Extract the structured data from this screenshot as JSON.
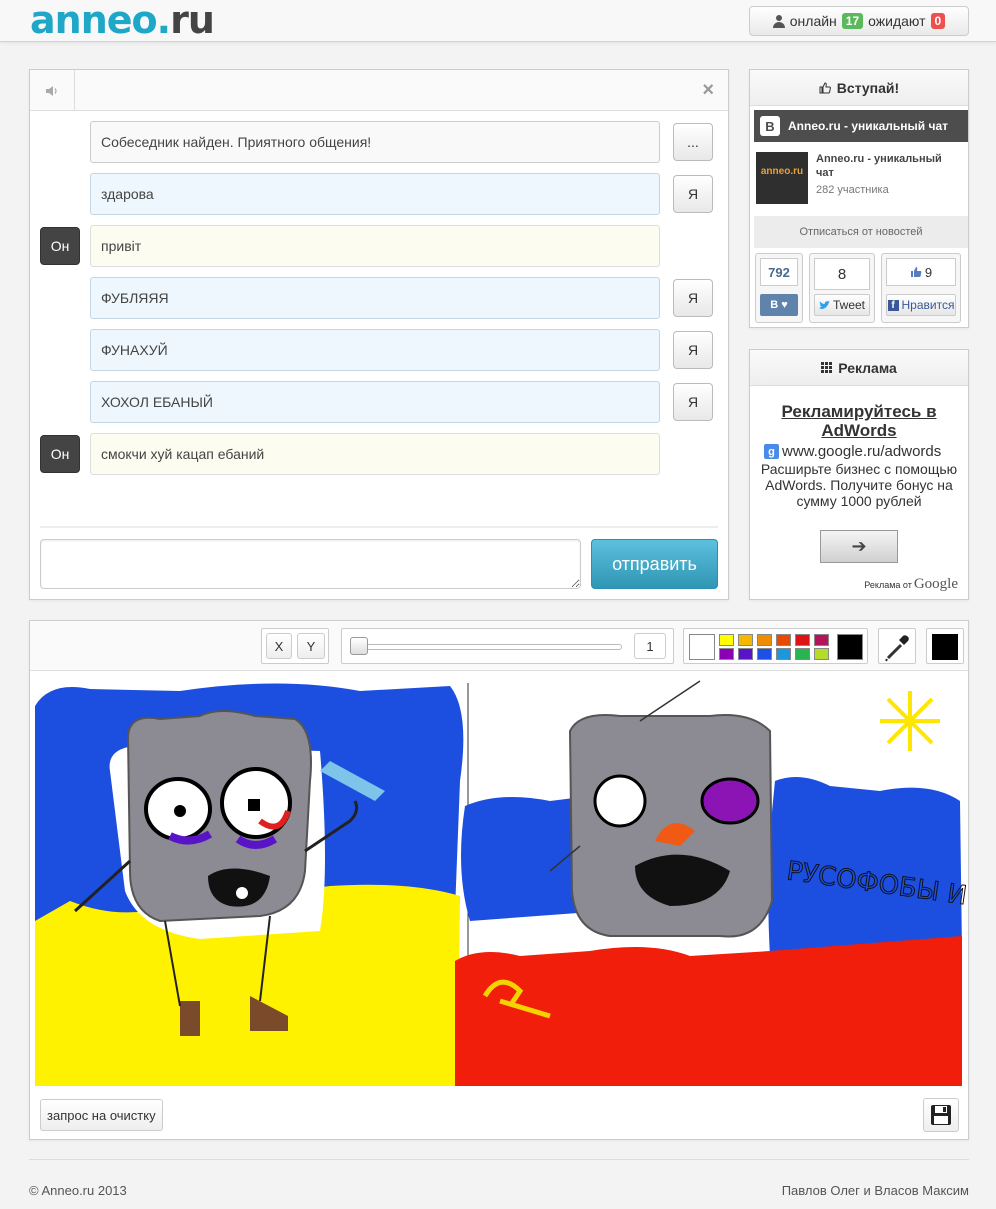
{
  "header": {
    "logo": {
      "main": "anneo",
      "dot": ".",
      "tld": "ru"
    },
    "status": {
      "online_label": "онлайн",
      "online_count": "17",
      "waiting_label": "ожидают",
      "waiting_count": "0"
    }
  },
  "chat": {
    "messages": [
      {
        "text": "Собеседник найден. Приятного общения!",
        "kind": "system",
        "side_label": "..."
      },
      {
        "text": "здарова",
        "kind": "me",
        "side_label": "Я"
      },
      {
        "text": "привіт",
        "kind": "him",
        "side_label": "Он"
      },
      {
        "text": "ФУБЛЯЯЯ",
        "kind": "me",
        "side_label": "Я"
      },
      {
        "text": "ФУНАХУЙ",
        "kind": "me",
        "side_label": "Я"
      },
      {
        "text": "ХОХОЛ ЕБАНЫЙ",
        "kind": "me",
        "side_label": "Я"
      },
      {
        "text": "смокчи хуй кацап ебаний",
        "kind": "him",
        "side_label": "Он"
      }
    ],
    "input_value": "",
    "send_label": "отправить"
  },
  "vk": {
    "title": "Вступай!",
    "group_header": "Anneo.ru - уникальный чат",
    "avatar_text": "anneo.ru",
    "group_name": "Anneo.ru - уникальный чат",
    "members": "282 участника",
    "unsubscribe": "Отписаться от новостей",
    "vk_count": "792",
    "tw_count": "8",
    "tw_label": "Tweet",
    "fb_count": "9",
    "fb_label": "Нравится"
  },
  "ads": {
    "title": "Реклама",
    "headline": "Рекламируйтесь в AdWords",
    "url": "www.google.ru/adwords",
    "body": "Расширьте бизнес с помощью AdWords. Получите бонус на сумму 1000 рублей",
    "footer_prefix": "Реклама от",
    "footer_brand": "Google"
  },
  "draw": {
    "x_label": "X",
    "y_label": "Y",
    "brush_size": "1",
    "brush_size_fraction": 0.0,
    "palette": [
      "#ffff00",
      "#f5b800",
      "#f08c00",
      "#e84a00",
      "#dc1414",
      "#b4145a",
      "#8c00b4",
      "#5a14c8",
      "#1e50e6",
      "#1e96dc",
      "#28b450",
      "#b4dc28"
    ],
    "current_color": "#000000",
    "canvas_text": "РУСОФОБЫ И ДИТЕ НАХУЙ!",
    "clear_label": "запрос на очистку"
  },
  "footer": {
    "copyright": "© Anneo.ru 2013",
    "authors": "Павлов Олег и Власов Максим"
  }
}
